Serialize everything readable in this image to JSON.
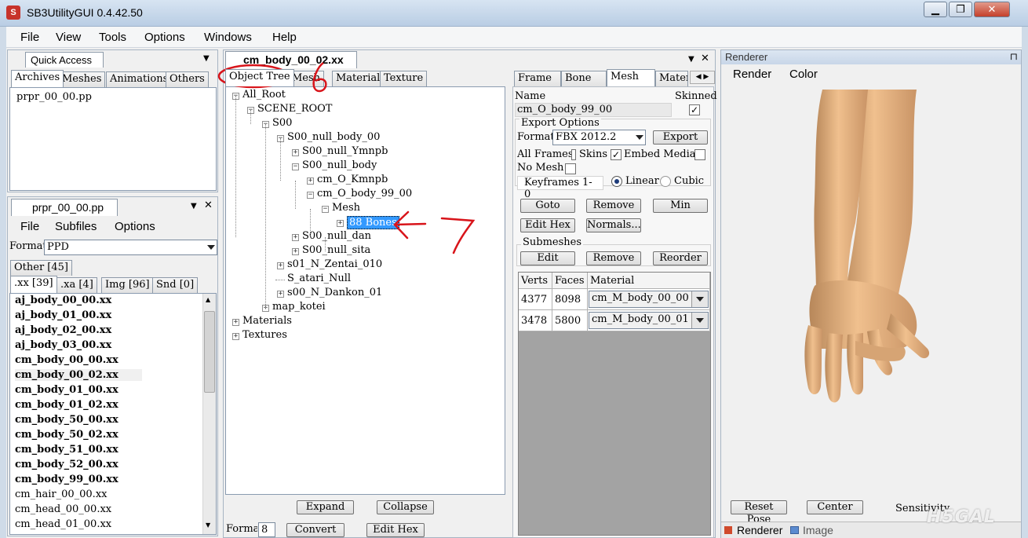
{
  "window": {
    "title": "SB3UtilityGUI 0.4.42.50",
    "minimize": "▁",
    "restore": "❐",
    "close": "✕"
  },
  "menu": [
    "File",
    "View",
    "Tools",
    "Options",
    "Windows",
    "Help"
  ],
  "quick_access": {
    "title": "Quick Access",
    "tabs": [
      "Archives",
      "Meshes",
      "Animations",
      "Others"
    ],
    "items": [
      "prpr_00_00.pp"
    ]
  },
  "pp_panel": {
    "title": "prpr_00_00.pp",
    "menu": [
      "File",
      "Subfiles",
      "Options"
    ],
    "format_label": "Format",
    "format_value": "PPD",
    "other_tab": "Other [45]",
    "tabs": [
      ".xx [39]",
      ".xa [4]",
      "Img [96]",
      "Snd [0]"
    ],
    "files": [
      {
        "name": "aj_body_00_00.xx",
        "bold": true
      },
      {
        "name": "aj_body_01_00.xx",
        "bold": true
      },
      {
        "name": "aj_body_02_00.xx",
        "bold": true
      },
      {
        "name": "aj_body_03_00.xx",
        "bold": true
      },
      {
        "name": "cm_body_00_00.xx",
        "bold": true
      },
      {
        "name": "cm_body_00_02.xx",
        "bold": true
      },
      {
        "name": "cm_body_01_00.xx",
        "bold": true
      },
      {
        "name": "cm_body_01_02.xx",
        "bold": true
      },
      {
        "name": "cm_body_50_00.xx",
        "bold": true
      },
      {
        "name": "cm_body_50_02.xx",
        "bold": true
      },
      {
        "name": "cm_body_51_00.xx",
        "bold": true
      },
      {
        "name": "cm_body_52_00.xx",
        "bold": true
      },
      {
        "name": "cm_body_99_00.xx",
        "bold": true
      },
      {
        "name": "cm_hair_00_00.xx",
        "bold": false
      },
      {
        "name": "cm_head_00_00.xx",
        "bold": false
      },
      {
        "name": "cm_head_01_00.xx",
        "bold": false
      }
    ]
  },
  "editor": {
    "title": "cm_body_00_02.xx",
    "tabs": [
      "Object Tree",
      "Mesh",
      "Material",
      "Texture"
    ],
    "tree": [
      {
        "label": "All_Root",
        "exp": "-"
      },
      {
        "label": "SCENE_ROOT",
        "exp": "-"
      },
      {
        "label": "S00",
        "exp": "-"
      },
      {
        "label": "S00_null_body_00",
        "exp": "-"
      },
      {
        "label": "S00_null_Ymnpb",
        "exp": "+"
      },
      {
        "label": "S00_null_body",
        "exp": "-"
      },
      {
        "label": "cm_O_Kmnpb",
        "exp": "+"
      },
      {
        "label": "cm_O_body_99_00",
        "exp": "-"
      },
      {
        "label": "Mesh",
        "exp": "-"
      },
      {
        "label": "88 Bones",
        "exp": "+"
      },
      {
        "label": "S00_null_dan",
        "exp": "+"
      },
      {
        "label": "S00_null_sita",
        "exp": "+"
      },
      {
        "label": "s01_N_Zentai_010",
        "exp": "+"
      },
      {
        "label": "S_atari_Null",
        "exp": ""
      },
      {
        "label": "s00_N_Dankon_01",
        "exp": "+"
      },
      {
        "label": "map_kotei",
        "exp": "+"
      },
      {
        "label": "Materials",
        "exp": "+"
      },
      {
        "label": "Textures",
        "exp": "+"
      }
    ],
    "expand": "Expand",
    "collapse": "Collapse",
    "format_label": "Forma",
    "format_value": "8",
    "convert": "Convert",
    "edit_hex": "Edit Hex"
  },
  "mesh_panel": {
    "tabs": [
      "Frame",
      "Bone",
      "Mesh",
      "Mater"
    ],
    "name_label": "Name",
    "name_value": "cm_O_body_99_00",
    "skinned_label": "Skinned",
    "export_options": "Export Options",
    "format_label": "Format",
    "format_value": "FBX 2012.2",
    "export": "Export",
    "all_frames": "All Frames",
    "skins": "Skins",
    "embed_media": "Embed Media",
    "no_mesh": "No Mesh",
    "keyframes": "Keyframes 1-0",
    "linear": "Linear",
    "cubic": "Cubic",
    "goto": "Goto",
    "remove": "Remove",
    "min": "Min",
    "edit_hex": "Edit Hex",
    "normals": "Normals...",
    "submeshes": "Submeshes",
    "edit": "Edit",
    "remove2": "Remove",
    "reorder": "Reorder",
    "table": {
      "headers": [
        "Verts",
        "Faces",
        "Material"
      ],
      "rows": [
        [
          "4377",
          "8098",
          "cm_M_body_00_00"
        ],
        [
          "3478",
          "5800",
          "cm_M_body_00_01"
        ]
      ]
    }
  },
  "renderer": {
    "title": "Renderer",
    "pin": "⊓",
    "menu": [
      "Render",
      "Color"
    ],
    "reset_pose": "Reset Pose",
    "center": "Center",
    "sensitivity": "Sensitivity",
    "bottom_tabs": [
      "Renderer",
      "Image"
    ],
    "bg_color": "#131348",
    "watermark": "H5GAL"
  },
  "annotations": {
    "label_6": "6",
    "label_7": "7",
    "color": "#d8141a"
  }
}
